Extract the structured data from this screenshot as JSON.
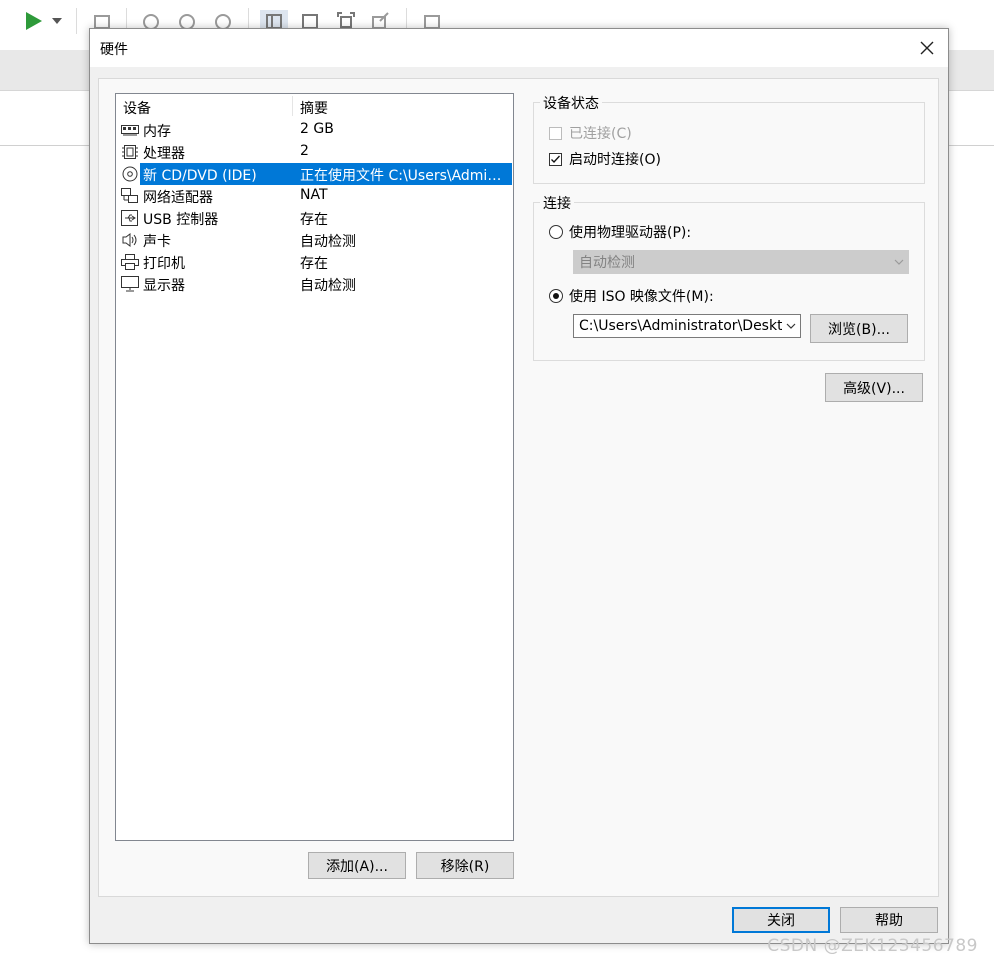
{
  "background": {
    "watermark": "CSDN @ZEK123456789"
  },
  "dialog": {
    "title": "硬件",
    "close_glyph": "✕"
  },
  "device_list": {
    "columns": [
      "设备",
      "摘要"
    ],
    "rows": [
      {
        "icon": "memory-icon",
        "name": "内存",
        "summary": "2 GB",
        "selected": false
      },
      {
        "icon": "processor-icon",
        "name": "处理器",
        "summary": "2",
        "selected": false
      },
      {
        "icon": "cd-dvd-icon",
        "name": "新 CD/DVD (IDE)",
        "summary": "正在使用文件 C:\\Users\\Administrator\\Desktop",
        "selected": true
      },
      {
        "icon": "network-adapter-icon",
        "name": "网络适配器",
        "summary": "NAT",
        "selected": false
      },
      {
        "icon": "usb-icon",
        "name": "USB 控制器",
        "summary": "存在",
        "selected": false
      },
      {
        "icon": "sound-card-icon",
        "name": "声卡",
        "summary": "自动检测",
        "selected": false
      },
      {
        "icon": "printer-icon",
        "name": "打印机",
        "summary": "存在",
        "selected": false
      },
      {
        "icon": "display-icon",
        "name": "显示器",
        "summary": "自动检测",
        "selected": false
      }
    ],
    "add_button": "添加(A)...",
    "remove_button": "移除(R)"
  },
  "device_status": {
    "title": "设备状态",
    "connected_label": "已连接(C)",
    "connected_checked": false,
    "connected_enabled": false,
    "connect_at_power_on_label": "启动时连接(O)",
    "connect_at_power_on_checked": true
  },
  "connection": {
    "title": "连接",
    "physical_drive_label": "使用物理驱动器(P):",
    "physical_drive_selected": false,
    "physical_drive_value": "自动检测",
    "iso_label": "使用 ISO 映像文件(M):",
    "iso_selected": true,
    "iso_path": "C:\\Users\\Administrator\\Deskto",
    "browse_button": "浏览(B)..."
  },
  "advanced_button": "高级(V)...",
  "footer": {
    "close_button": "关闭",
    "help_button": "帮助"
  },
  "colors": {
    "selection": "#0078d7",
    "dialog_bg": "#f0f0f0",
    "panel_bg": "#f9f9f9",
    "play_green": "#2e9a3a"
  }
}
